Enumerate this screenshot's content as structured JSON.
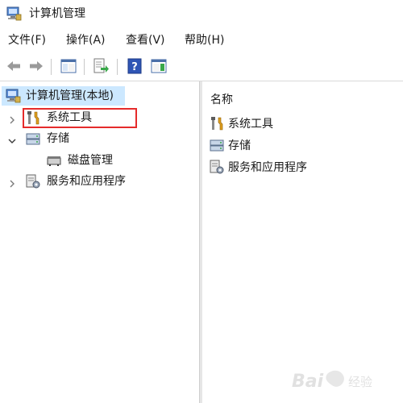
{
  "window": {
    "title": "计算机管理",
    "icon": "computer-management-icon"
  },
  "menu": {
    "items": [
      "文件(F)",
      "操作(A)",
      "查看(V)",
      "帮助(H)"
    ]
  },
  "toolbar": {
    "buttons": [
      {
        "icon": "back-arrow-icon"
      },
      {
        "icon": "forward-arrow-icon"
      },
      {
        "icon": "show-hide-console-tree-icon"
      },
      {
        "icon": "export-list-icon"
      },
      {
        "icon": "help-icon"
      },
      {
        "icon": "show-action-pane-icon"
      }
    ]
  },
  "tree": {
    "root": {
      "label": "计算机管理(本地)",
      "icon": "computer-management-icon",
      "selected": true
    },
    "nodes": [
      {
        "label": "系统工具",
        "icon": "system-tools-icon",
        "expander": "collapsed",
        "highlighted": true
      },
      {
        "label": "存储",
        "icon": "storage-icon",
        "expander": "expanded"
      },
      {
        "label": "磁盘管理",
        "icon": "disk-management-icon",
        "expander": "none"
      },
      {
        "label": "服务和应用程序",
        "icon": "services-apps-icon",
        "expander": "collapsed"
      }
    ]
  },
  "list": {
    "column_header": "名称",
    "items": [
      {
        "label": "系统工具",
        "icon": "system-tools-icon"
      },
      {
        "label": "存储",
        "icon": "storage-icon"
      },
      {
        "label": "服务和应用程序",
        "icon": "services-apps-icon"
      }
    ]
  },
  "colors": {
    "selection": "#cce8ff",
    "highlight_box": "#e52b2b",
    "pane_divider": "#e6e6e6"
  },
  "watermark": {
    "brand": "Bai 经验"
  }
}
